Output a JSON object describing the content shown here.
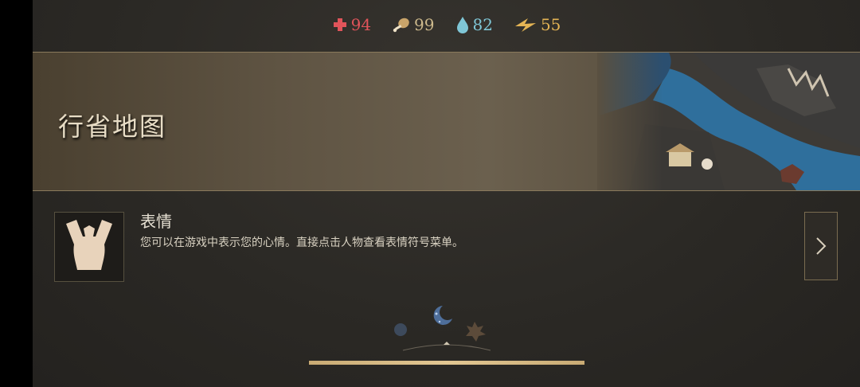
{
  "stats": [
    {
      "icon": "health-cross-icon",
      "value": "94",
      "color": "#e0545a"
    },
    {
      "icon": "meat-leg-icon",
      "value": "99",
      "color": "#cdb98c"
    },
    {
      "icon": "water-drop-icon",
      "value": "82",
      "color": "#7fc6d6"
    },
    {
      "icon": "lightning-icon",
      "value": "55",
      "color": "#e4b454"
    }
  ],
  "banner": {
    "title": "行省地图"
  },
  "tip": {
    "title": "表情",
    "description": "您可以在游戏中表示您的心情。直接点击人物查看表情符号菜单。"
  },
  "progress": {
    "fraction": 1.0
  }
}
